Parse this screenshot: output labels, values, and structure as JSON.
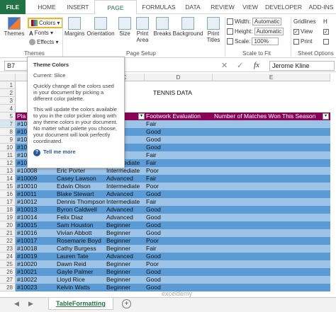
{
  "ribbon": {
    "tabs": [
      "FILE",
      "HOME",
      "INSERT",
      "PAGE LAYOUT",
      "FORMULAS",
      "DATA",
      "REVIEW",
      "VIEW",
      "DEVELOPER",
      "ADD-INS"
    ],
    "themes_group": {
      "themes_label": "Themes",
      "colors_label": "Colors",
      "fonts_label": "Fonts",
      "effects_label": "Effects",
      "group_label": "Themes"
    },
    "page_setup": {
      "margins": "Margins",
      "orientation": "Orientation",
      "size": "Size",
      "print_area_1": "Print",
      "print_area_2": "Area",
      "breaks": "Breaks",
      "background": "Background",
      "print_titles_1": "Print",
      "print_titles_2": "Titles",
      "group_label": "Page Setup"
    },
    "scale_to_fit": {
      "width_label": "Width:",
      "width_value": "Automatic",
      "height_label": "Height:",
      "height_value": "Automatic",
      "scale_label": "Scale:",
      "scale_value": "100%",
      "group_label": "Scale to Fit"
    },
    "sheet_options": {
      "gridlines": "Gridlines",
      "view": "View",
      "print": "Print",
      "group_label": "Sheet Options"
    }
  },
  "formula_bar": {
    "name_box": "B7",
    "fx": "fx",
    "value": "Jerome Kline"
  },
  "tooltip": {
    "title": "Theme Colors",
    "current": "Current: Slice",
    "para1": "Quickly change all the colors used in your document by picking a different color palette.",
    "para2": "This will update the colors available to you in the color picker along with any theme colors in your document. No matter what palette you choose, your document will look perfectly coordinated.",
    "help": "Tell me more"
  },
  "sheet": {
    "col_headers": [
      "A",
      "B",
      "C",
      "D",
      "E"
    ],
    "title": "TENNIS DATA",
    "header_row": [
      "Pla",
      "",
      "",
      "Footwork Evaluation",
      "Number of Matches Won This Season"
    ],
    "rows": [
      {
        "n": "7",
        "a": "#10",
        "b": "",
        "c": "ediate",
        "d": "Fair"
      },
      {
        "n": "8",
        "a": "#10",
        "b": "",
        "c": "",
        "d": "Good"
      },
      {
        "n": "9",
        "a": "#10",
        "b": "",
        "c": "",
        "d": "Good"
      },
      {
        "n": "10",
        "a": "#10",
        "b": "",
        "c": "",
        "d": "Good"
      },
      {
        "n": "11",
        "a": "#10",
        "b": "",
        "c": "",
        "d": "Fair"
      },
      {
        "n": "12",
        "a": "#10005",
        "b": "Stephen Fletcher",
        "c": "Intermediate",
        "d": "Fair"
      },
      {
        "n": "13",
        "a": "#10008",
        "b": "Eric Porter",
        "c": "Intermediate",
        "d": "Poor"
      },
      {
        "n": "14",
        "a": "#10009",
        "b": "Casey Lawson",
        "c": "Advanced",
        "d": "Fair"
      },
      {
        "n": "15",
        "a": "#10010",
        "b": "Edwin Olson",
        "c": "Intermediate",
        "d": "Poor"
      },
      {
        "n": "16",
        "a": "#10011",
        "b": "Blake Stewart",
        "c": "Advanced",
        "d": "Good"
      },
      {
        "n": "17",
        "a": "#10012",
        "b": "Dennis Thompson",
        "c": "Intermediate",
        "d": "Fair"
      },
      {
        "n": "18",
        "a": "#10013",
        "b": "Byron Caldwell",
        "c": "Advanced",
        "d": "Good"
      },
      {
        "n": "19",
        "a": "#10014",
        "b": "Felix Diaz",
        "c": "Advanced",
        "d": "Good"
      },
      {
        "n": "20",
        "a": "#10015",
        "b": "Sam Houston",
        "c": "Beginner",
        "d": "Good"
      },
      {
        "n": "21",
        "a": "#10016",
        "b": "Vivian Abbott",
        "c": "Beginner",
        "d": "Good"
      },
      {
        "n": "22",
        "a": "#10017",
        "b": "Rosemarie Boyd",
        "c": "Beginner",
        "d": "Poor"
      },
      {
        "n": "23",
        "a": "#10018",
        "b": "Cathy Burgess",
        "c": "Beginner",
        "d": "Fair"
      },
      {
        "n": "24",
        "a": "#10019",
        "b": "Lauren Tate",
        "c": "Advanced",
        "d": "Good"
      },
      {
        "n": "25",
        "a": "#10020",
        "b": "Dawn Reid",
        "c": "Beginner",
        "d": "Poor"
      },
      {
        "n": "26",
        "a": "#10021",
        "b": "Gayle Palmer",
        "c": "Beginner",
        "d": "Good"
      },
      {
        "n": "27",
        "a": "#10022",
        "b": "Lloyd Rice",
        "c": "Beginner",
        "d": "Good"
      },
      {
        "n": "28",
        "a": "#10023",
        "b": "Kelvin Watts",
        "c": "Beginner",
        "d": "Good"
      }
    ]
  },
  "sheet_tab": "TableFormatting",
  "add_sheet": "+",
  "watermark": "exceldemy",
  "colors": {
    "excel_green": "#217346",
    "band_light": "#9dc3e6",
    "band_dark": "#5b9bd5",
    "header_magenta": "#8b0057"
  }
}
